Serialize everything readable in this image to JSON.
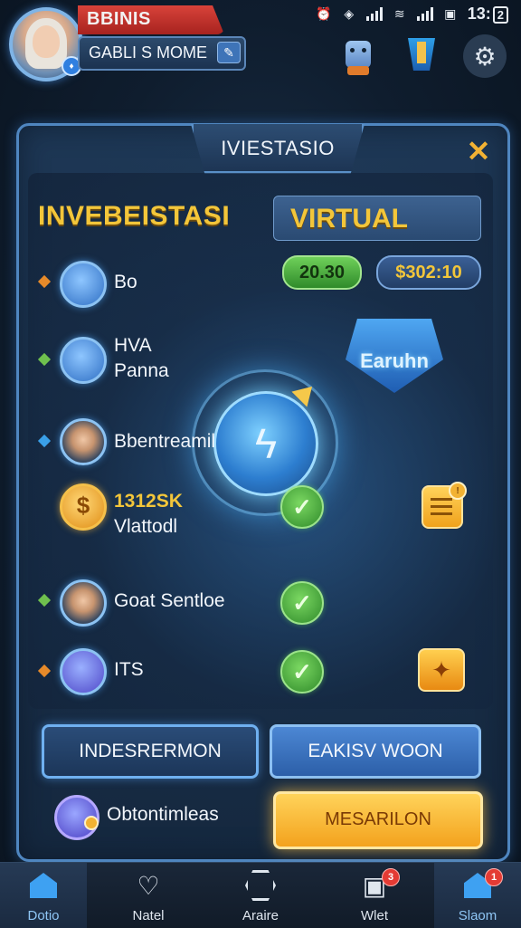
{
  "status_bar": {
    "time": "13:",
    "battery": "2"
  },
  "header": {
    "banner": "BBINIS",
    "subtitle": "GABLI S MOME",
    "icons": [
      "edit-icon",
      "robot-icon",
      "cup-icon",
      "gear-icon"
    ]
  },
  "panel": {
    "tab_title": "IVIESTASIO",
    "close": "✕",
    "title_left": "INVEBEISTASI",
    "title_right": "VIRTUAL",
    "stat_green": "20.30",
    "stat_blue": "$302:10",
    "badge_text": "Earuhn",
    "rows": [
      {
        "line1": "Bo",
        "line2": "",
        "diamond": "#e68a2a"
      },
      {
        "line1": "HVA",
        "line2": "Panna",
        "diamond": "#6fc04e"
      },
      {
        "line1": "Bbentreamil",
        "line2": "",
        "diamond": "#3aa0e8"
      },
      {
        "line1": "1312SK",
        "line2": "Vlattodl",
        "diamond": ""
      },
      {
        "line1": "Goat Sentloe",
        "line2": "",
        "diamond": "#6fc04e"
      },
      {
        "line1": "ITS",
        "line2": "",
        "diamond": "#e68a2a"
      }
    ],
    "buttons": {
      "left": "INDESRERMON",
      "right": "EAKISV WOON",
      "gold": "MESARILON"
    },
    "footer_text": "Obtontimleas",
    "notif_badge": "!"
  },
  "nav": {
    "items": [
      {
        "label": "Dotio",
        "icon": "house-icon",
        "active": true
      },
      {
        "label": "Natel",
        "icon": "heart-location-icon",
        "active": false
      },
      {
        "label": "Araire",
        "icon": "hexagon-icon",
        "active": false
      },
      {
        "label": "Wlet",
        "icon": "wallet-icon",
        "active": false,
        "badge": "3"
      },
      {
        "label": "Slaom",
        "icon": "house-icon",
        "active": true,
        "badge": "1"
      }
    ]
  },
  "colors": {
    "gold": "#f3c63a",
    "accent_blue": "#4aa7f5",
    "panel_border": "#4f86c0",
    "banner_red": "#d8433a"
  }
}
